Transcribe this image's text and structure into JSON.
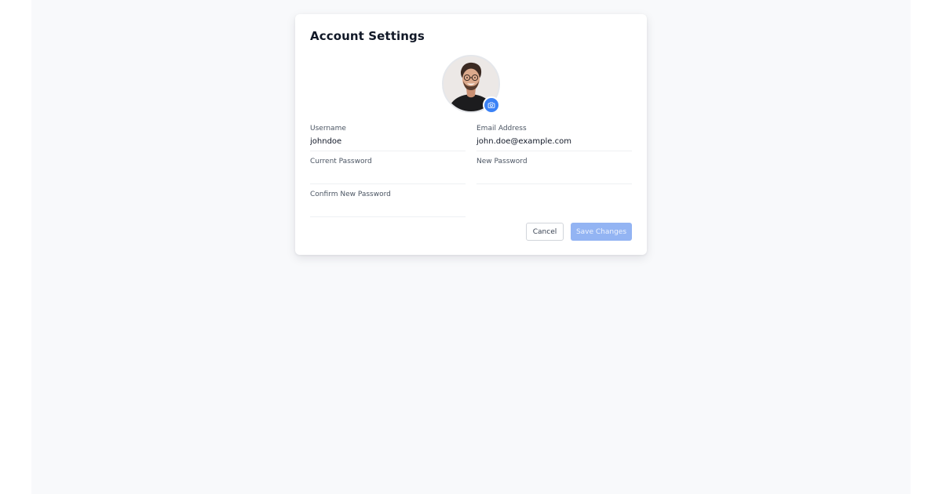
{
  "settings": {
    "title": "Account Settings",
    "avatar_icon": "user-photo",
    "camera_icon": "camera-icon"
  },
  "fields": {
    "username": {
      "label": "Username",
      "value": "johndoe",
      "placeholder": ""
    },
    "email": {
      "label": "Email Address",
      "value": "john.doe@example.com",
      "placeholder": ""
    },
    "current_password": {
      "label": "Current Password",
      "value": "",
      "placeholder": ""
    },
    "new_password": {
      "label": "New Password",
      "value": "",
      "placeholder": ""
    },
    "confirm_password": {
      "label": "Confirm New Password",
      "value": "",
      "placeholder": ""
    }
  },
  "actions": {
    "cancel_label": "Cancel",
    "save_label": "Save Changes"
  },
  "colors": {
    "accent": "#3b82f6",
    "save_disabled": "#93b4f3",
    "page_background": "#f8f9fb"
  }
}
